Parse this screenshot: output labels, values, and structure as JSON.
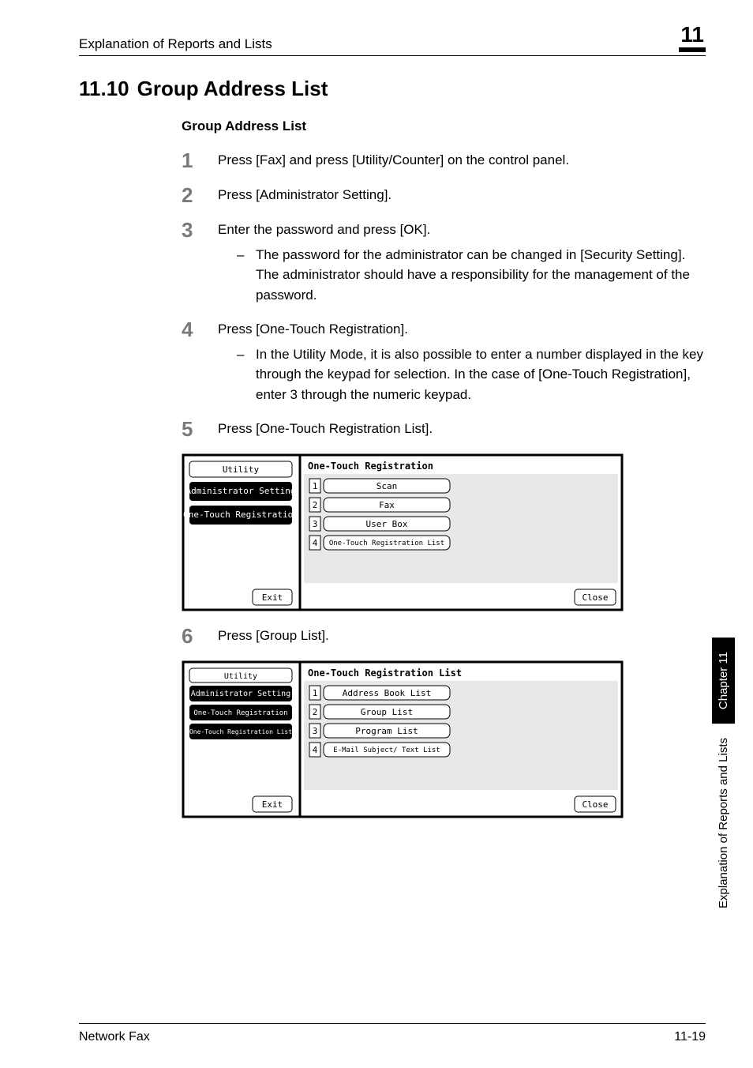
{
  "header": {
    "title": "Explanation of Reports and Lists",
    "chapter_no": "11"
  },
  "section": {
    "number": "11.10",
    "title": "Group Address List"
  },
  "subsection_title": "Group Address List",
  "steps": [
    {
      "n": "1",
      "text": "Press [Fax] and press [Utility/Counter] on the control panel."
    },
    {
      "n": "2",
      "text": "Press [Administrator Setting]."
    },
    {
      "n": "3",
      "text": "Enter the password and press [OK].",
      "sub": [
        "The password for the administrator can be changed in [Security Setting]. The administrator should have a responsibility for the management of the password."
      ]
    },
    {
      "n": "4",
      "text": "Press [One-Touch Registration].",
      "sub": [
        "In the Utility Mode, it is also possible to enter a number displayed in the key through the keypad for selection. In the case of [One-Touch Registration], enter 3 through the numeric keypad."
      ]
    },
    {
      "n": "5",
      "text": "Press [One-Touch Registration List]."
    },
    {
      "n": "6",
      "text": "Press [Group List]."
    }
  ],
  "screen1": {
    "panel_title": "One-Touch Registration",
    "left": [
      "Utility",
      "Administrator Setting",
      "One-Touch Registration"
    ],
    "items": [
      {
        "n": "1",
        "label": "Scan"
      },
      {
        "n": "2",
        "label": "Fax"
      },
      {
        "n": "3",
        "label": "User Box"
      },
      {
        "n": "4",
        "label": "One-Touch Registration List"
      }
    ],
    "exit": "Exit",
    "close": "Close"
  },
  "screen2": {
    "panel_title": "One-Touch Registration List",
    "left": [
      "Utility",
      "Administrator Setting",
      "One-Touch Registration",
      "One-Touch Registration List"
    ],
    "items": [
      {
        "n": "1",
        "label": "Address Book List"
      },
      {
        "n": "2",
        "label": "Group List"
      },
      {
        "n": "3",
        "label": "Program List"
      },
      {
        "n": "4",
        "label": "E-Mail Subject/ Text List"
      }
    ],
    "exit": "Exit",
    "close": "Close"
  },
  "sidebar": {
    "chapter": "Chapter 11",
    "title": "Explanation of Reports and Lists"
  },
  "footer": {
    "left": "Network Fax",
    "right": "11-19"
  }
}
